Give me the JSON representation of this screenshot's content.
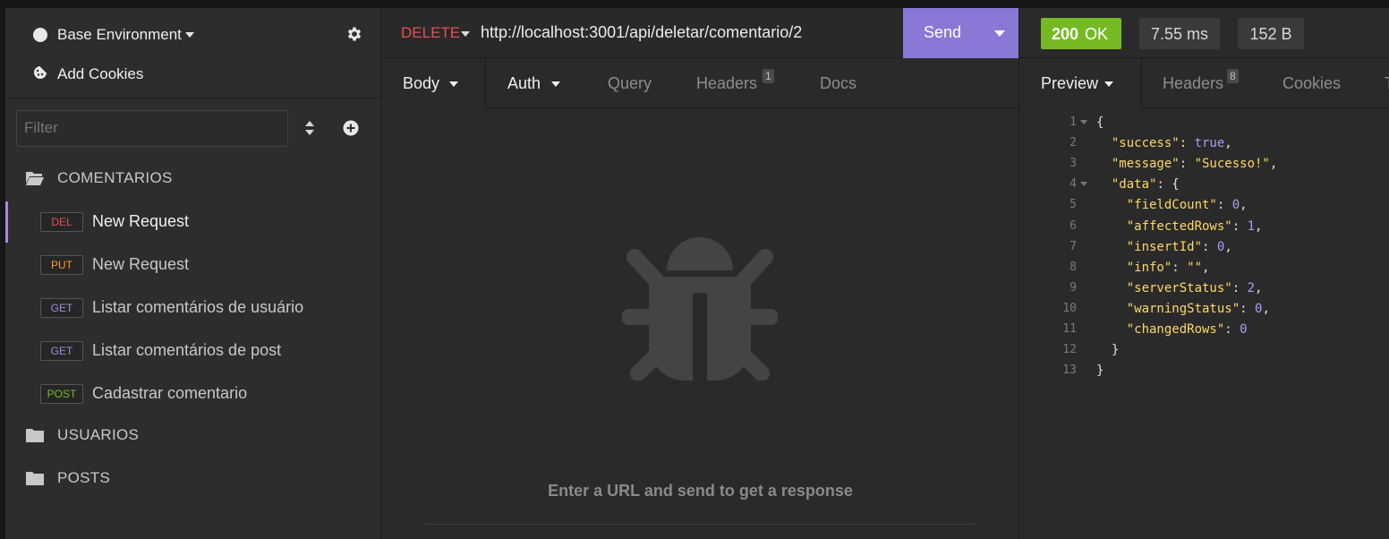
{
  "sidebar": {
    "environment": "Base Environment",
    "add_cookies": "Add Cookies",
    "filter_placeholder": "Filter",
    "folders": [
      {
        "label": "COMENTARIOS"
      },
      {
        "label": "USUARIOS"
      },
      {
        "label": "POSTS"
      }
    ],
    "requests": [
      {
        "method": "DEL",
        "method_color": "#e15252",
        "label": "New Request",
        "active": true
      },
      {
        "method": "PUT",
        "method_color": "#ff9a1f",
        "label": "New Request",
        "active": false
      },
      {
        "method": "GET",
        "method_color": "#a58bde",
        "label": "Listar comentários de usuário",
        "active": false
      },
      {
        "method": "GET",
        "method_color": "#a58bde",
        "label": "Listar comentários de post",
        "active": false
      },
      {
        "method": "POST",
        "method_color": "#75ba24",
        "label": "Cadastrar comentario",
        "active": false
      }
    ]
  },
  "request": {
    "method": "DELETE",
    "url": "http://localhost:3001/api/deletar/comentario/2",
    "send_label": "Send",
    "tabs": {
      "body": "Body",
      "auth": "Auth",
      "query": "Query",
      "headers": "Headers",
      "headers_count": "1",
      "docs": "Docs"
    },
    "empty_message": "Enter a URL and send to get a response"
  },
  "response": {
    "status_code": "200",
    "status_text": "OK",
    "time": "7.55 ms",
    "size": "152 B",
    "tabs": {
      "preview": "Preview",
      "headers": "Headers",
      "headers_count": "8",
      "cookies": "Cookies",
      "timeline_partial": "T"
    },
    "lines": [
      {
        "n": "1",
        "fold": true,
        "indent": "",
        "parts": [
          [
            "p",
            "{"
          ]
        ]
      },
      {
        "n": "2",
        "fold": false,
        "indent": "  ",
        "parts": [
          [
            "k",
            "\"success\""
          ],
          [
            "p",
            ": "
          ],
          [
            "b",
            "true"
          ],
          [
            "p",
            ","
          ]
        ]
      },
      {
        "n": "3",
        "fold": false,
        "indent": "  ",
        "parts": [
          [
            "k",
            "\"message\""
          ],
          [
            "p",
            ": "
          ],
          [
            "s",
            "\"Sucesso!\""
          ],
          [
            "p",
            ","
          ]
        ]
      },
      {
        "n": "4",
        "fold": true,
        "indent": "  ",
        "parts": [
          [
            "k",
            "\"data\""
          ],
          [
            "p",
            ": {"
          ]
        ]
      },
      {
        "n": "5",
        "fold": false,
        "indent": "    ",
        "parts": [
          [
            "k",
            "\"fieldCount\""
          ],
          [
            "p",
            ": "
          ],
          [
            "n",
            "0"
          ],
          [
            "p",
            ","
          ]
        ]
      },
      {
        "n": "6",
        "fold": false,
        "indent": "    ",
        "parts": [
          [
            "k",
            "\"affectedRows\""
          ],
          [
            "p",
            ": "
          ],
          [
            "n",
            "1"
          ],
          [
            "p",
            ","
          ]
        ]
      },
      {
        "n": "7",
        "fold": false,
        "indent": "    ",
        "parts": [
          [
            "k",
            "\"insertId\""
          ],
          [
            "p",
            ": "
          ],
          [
            "n",
            "0"
          ],
          [
            "p",
            ","
          ]
        ]
      },
      {
        "n": "8",
        "fold": false,
        "indent": "    ",
        "parts": [
          [
            "k",
            "\"info\""
          ],
          [
            "p",
            ": "
          ],
          [
            "s",
            "\"\""
          ],
          [
            "p",
            ","
          ]
        ]
      },
      {
        "n": "9",
        "fold": false,
        "indent": "    ",
        "parts": [
          [
            "k",
            "\"serverStatus\""
          ],
          [
            "p",
            ": "
          ],
          [
            "n",
            "2"
          ],
          [
            "p",
            ","
          ]
        ]
      },
      {
        "n": "10",
        "fold": false,
        "indent": "    ",
        "parts": [
          [
            "k",
            "\"warningStatus\""
          ],
          [
            "p",
            ": "
          ],
          [
            "n",
            "0"
          ],
          [
            "p",
            ","
          ]
        ]
      },
      {
        "n": "11",
        "fold": false,
        "indent": "    ",
        "parts": [
          [
            "k",
            "\"changedRows\""
          ],
          [
            "p",
            ": "
          ],
          [
            "n",
            "0"
          ]
        ]
      },
      {
        "n": "12",
        "fold": false,
        "indent": "  ",
        "parts": [
          [
            "p",
            "}"
          ]
        ]
      },
      {
        "n": "13",
        "fold": false,
        "indent": "",
        "parts": [
          [
            "p",
            "}"
          ]
        ]
      }
    ]
  },
  "colors": {
    "accent": "#8b77d6",
    "status_ok": "#75ba24",
    "delete_method": "#e15252"
  }
}
